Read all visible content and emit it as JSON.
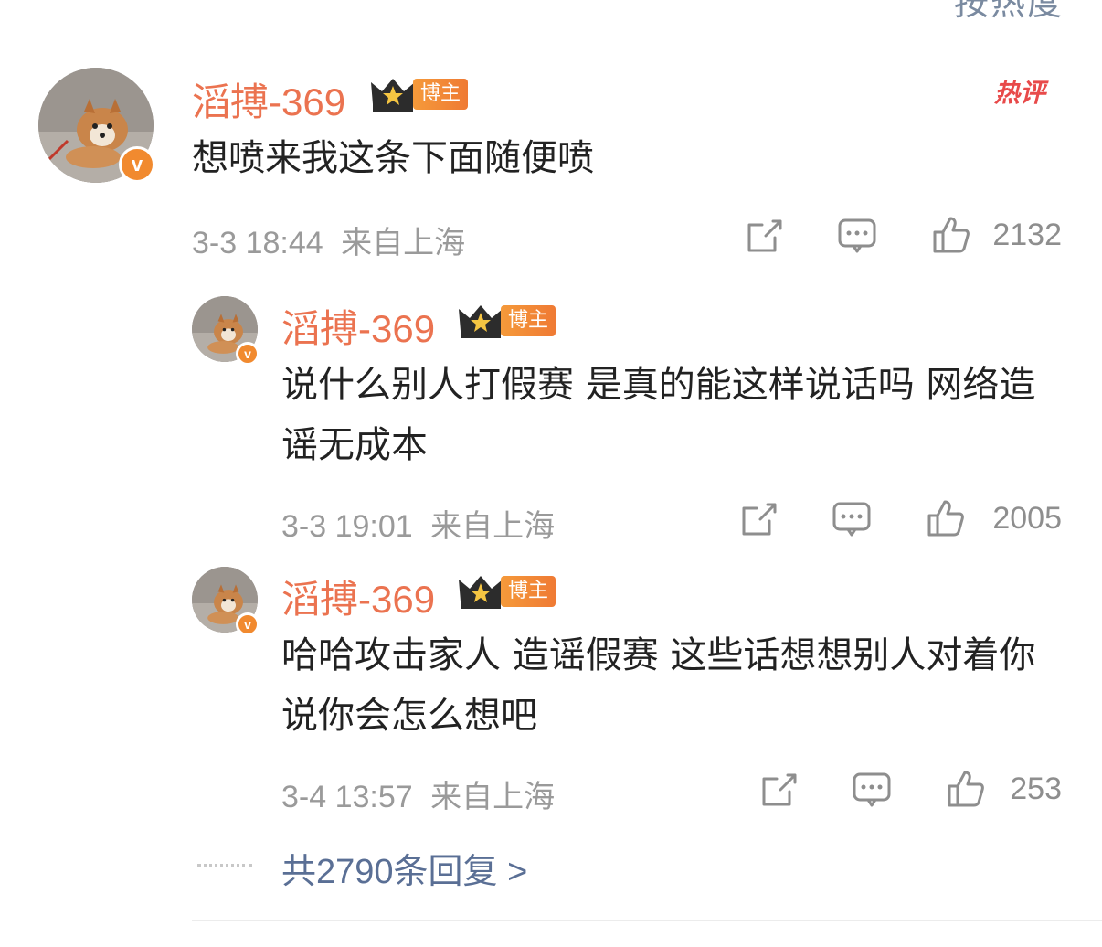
{
  "sort_label": "按热度",
  "hot_label": "热评",
  "main_comment": {
    "username": "滔搏-369",
    "role": "博主",
    "text": "想喷来我这条下面随便喷",
    "time": "3-3 18:44",
    "location": "来自上海",
    "likes": "2132"
  },
  "replies": [
    {
      "username": "滔搏-369",
      "role": "博主",
      "text": "说什么别人打假赛  是真的能这样说话吗  网络造谣无成本",
      "time": "3-3 19:01",
      "location": "来自上海",
      "likes": "2005"
    },
    {
      "username": "滔搏-369",
      "role": "博主",
      "text": "哈哈攻击家人 造谣假赛  这些话想想别人对着你说你会怎么想吧",
      "time": "3-4 13:57",
      "location": "来自上海",
      "likes": "253"
    }
  ],
  "more_replies_label": "共2790条回复 >",
  "colors": {
    "username": "#eb7350",
    "link": "#5a6f95",
    "meta": "#9a9a9a",
    "badge": "#f18a2f",
    "hot": "#e84a4a"
  },
  "icons": {
    "verified": "verified-v-icon",
    "crown": "crown-icon",
    "share": "share-icon",
    "comment": "comment-icon",
    "like": "like-icon"
  }
}
